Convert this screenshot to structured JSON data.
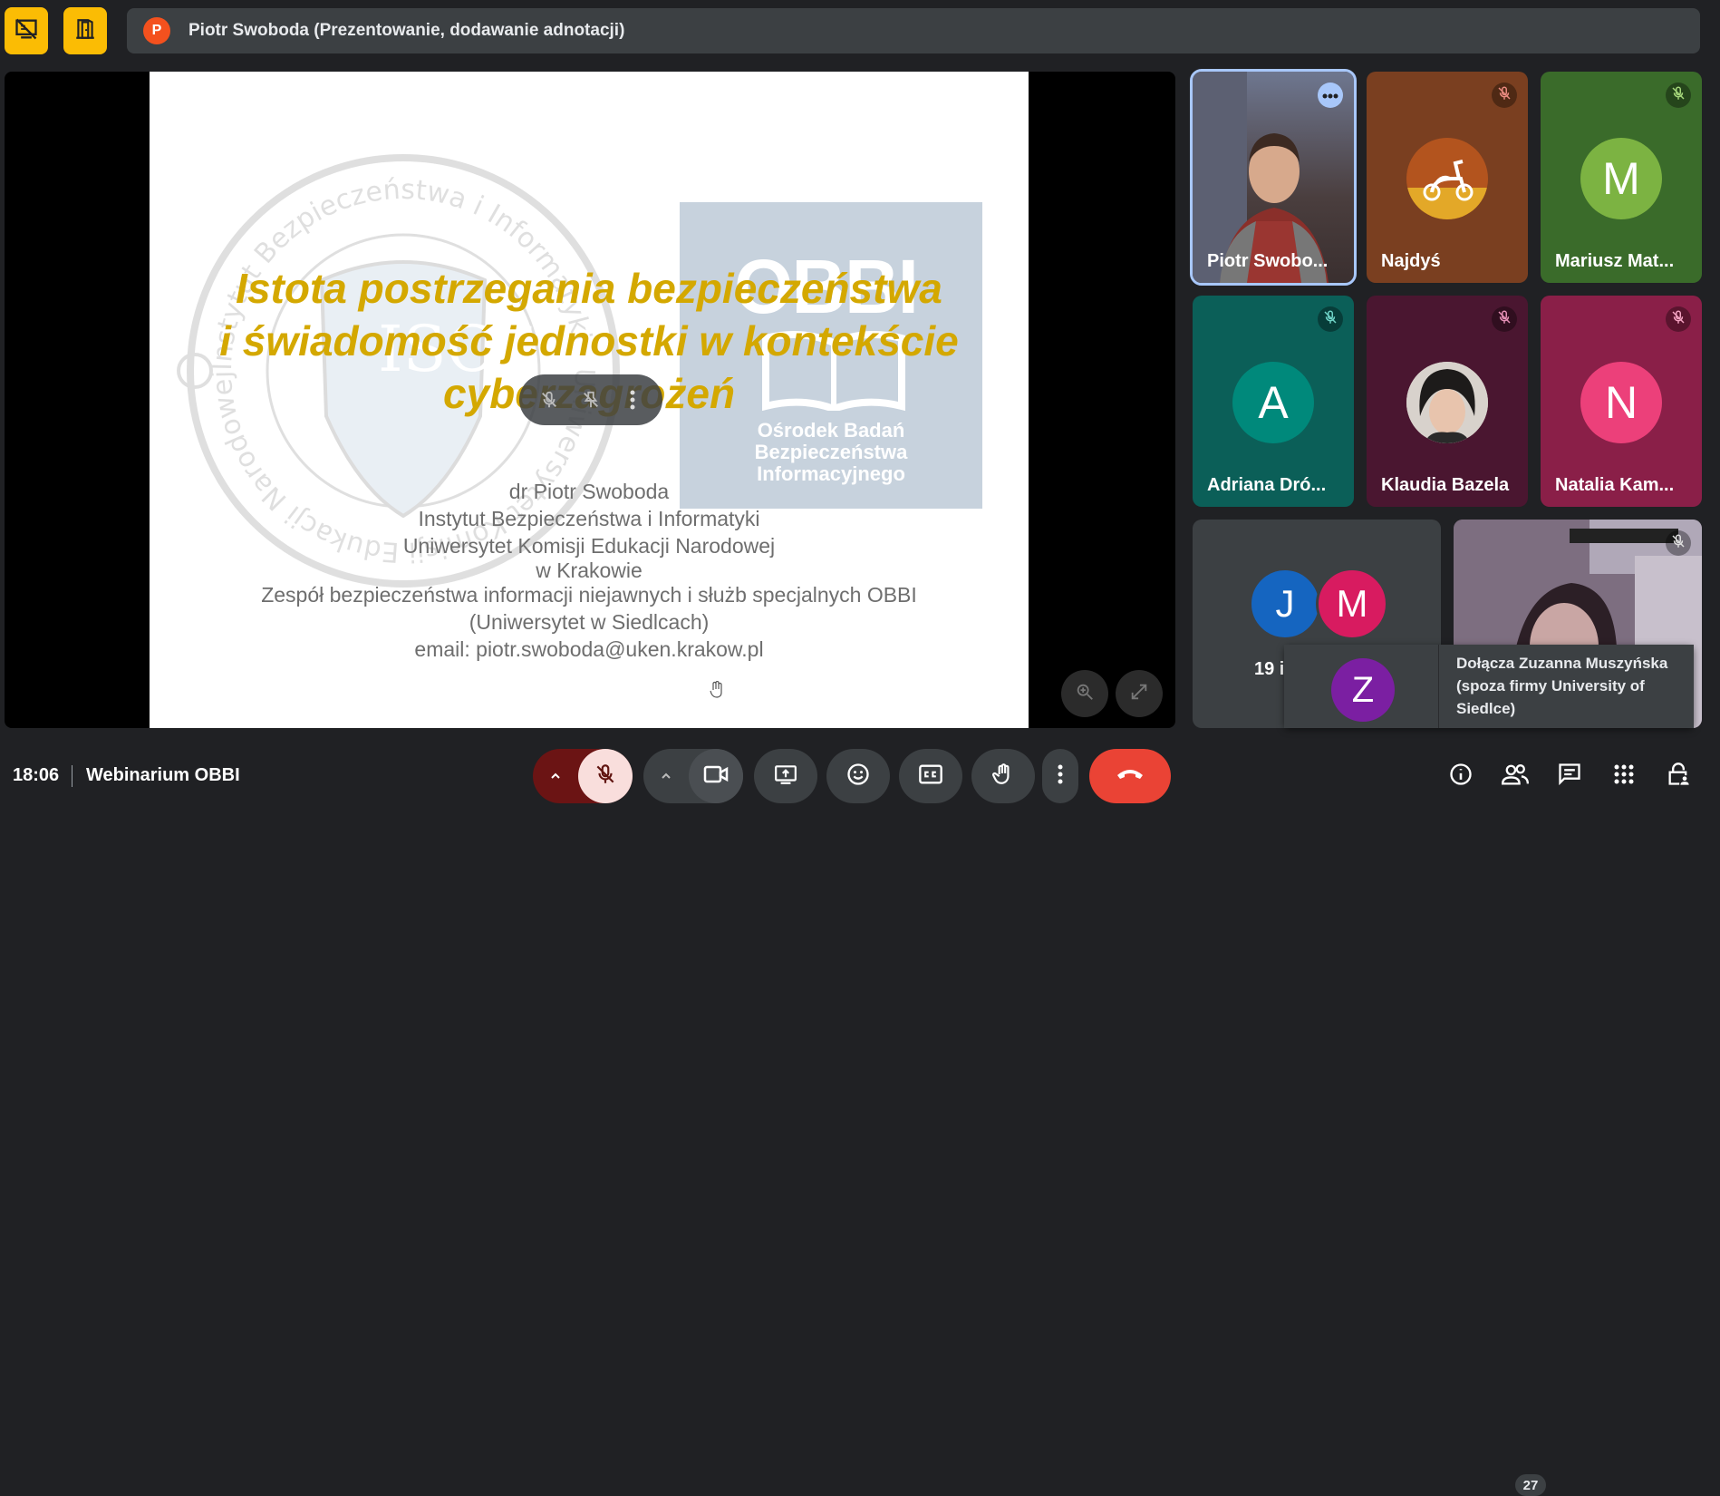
{
  "presenter": {
    "avatar_initial": "P",
    "title": "Piotr Swoboda (Prezentowanie, dodawanie adnotacji)"
  },
  "slide": {
    "title_lines": [
      "Istota postrzegania bezpieczeństwa",
      "i świadomość jednostki w kontekście",
      "cyberzagrożeń"
    ],
    "body_lines": [
      "dr Piotr Swoboda",
      "Instytut Bezpieczeństwa i Informatyki",
      "Uniwersytet Komisji Edukacji Narodowej",
      "w Krakowie",
      "Zespół bezpieczeństwa informacji niejawnych i służb specjalnych OBBI",
      "(Uniwersytet w Siedlcach)",
      "email: piotr.swoboda@uken.krakow.pl"
    ],
    "watermark_seal_text": "Instytut Bezpieczeństwa i Informatyki · Uniwersytet Komisji Edukacji Narodowej w Krakowie · Institute of Security and Computer Science",
    "watermark_seal_letters": "ISCS",
    "obbi_logo": {
      "acronym": "OBBI",
      "lines": [
        "Ośrodek Badań",
        "Bezpieczeństwa",
        "Informacyjnego"
      ]
    }
  },
  "participants": [
    {
      "name": "Piotr Swobo...",
      "kind": "video",
      "muted": false,
      "active": true
    },
    {
      "name": "Najdyś",
      "kind": "image",
      "muted": true
    },
    {
      "name": "Mariusz Mat...",
      "kind": "initial",
      "initial": "M",
      "color": "#7cb342",
      "muted": true
    },
    {
      "name": "Adriana Dró...",
      "kind": "initial",
      "initial": "A",
      "color": "#00897b",
      "muted": true
    },
    {
      "name": "Klaudia Bazela",
      "kind": "image",
      "muted": true
    },
    {
      "name": "Natalia Kam...",
      "kind": "initial",
      "initial": "N",
      "color": "#ec407a",
      "muted": true
    }
  ],
  "others_tile": {
    "initials": [
      "J",
      "M"
    ],
    "colors": [
      "#1565c0",
      "#d81b60"
    ],
    "label": "19 in"
  },
  "toast": {
    "initial": "Z",
    "text": "Dołącza Zuzanna Muszyńska (spoza firmy University of Siedlce)"
  },
  "bottom": {
    "time": "18:06",
    "meeting_name": "Webinarium OBBI",
    "people_count": "27"
  },
  "colors": {
    "accent_yellow": "#fbbc04",
    "end_call_red": "#ea4335",
    "mic_off_bg": "#f9dedc",
    "title_gold": "#d4a800"
  }
}
